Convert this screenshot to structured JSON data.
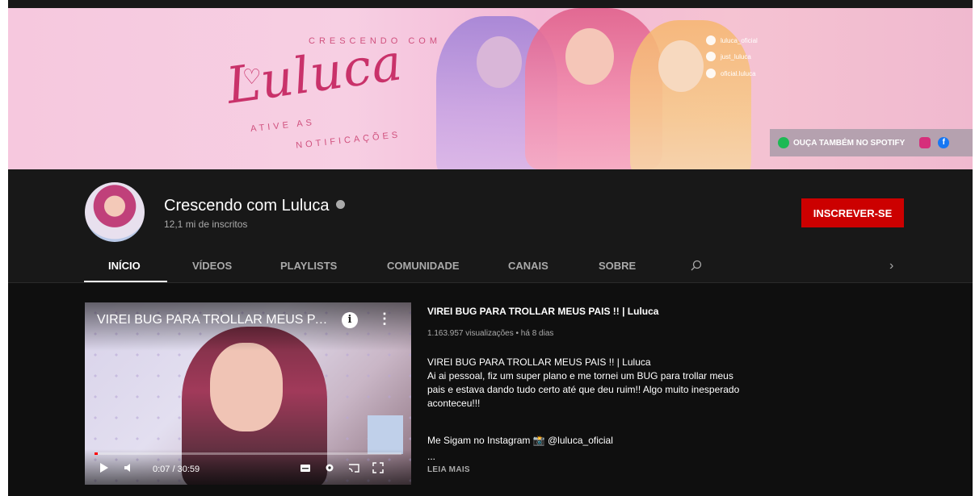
{
  "banner": {
    "brand_top": "CRESCENDO COM",
    "brand_logo": "Luluca",
    "note_line1": "ATIVE AS",
    "note_line2": "NOTIFICAÇÕES",
    "social": [
      {
        "icon": "instagram-icon",
        "handle": "luluca_oficial"
      },
      {
        "icon": "tiktok-icon",
        "handle": "just_luluca"
      },
      {
        "icon": "facebook-icon",
        "handle": "oficial.luluca"
      }
    ],
    "spotify_label": "OUÇA TAMBÉM NO SPOTIFY",
    "colors": {
      "accent": "#c9326a",
      "spotify": "#1db954"
    }
  },
  "channel": {
    "name": "Crescendo com Luluca",
    "subscribers": "12,1 mi de inscritos",
    "subscribe_label": "INSCREVER-SE",
    "subscribe_color": "#cc0000"
  },
  "tabs": [
    {
      "label": "INÍCIO",
      "active": true
    },
    {
      "label": "VÍDEOS",
      "active": false
    },
    {
      "label": "PLAYLISTS",
      "active": false
    },
    {
      "label": "COMUNIDADE",
      "active": false
    },
    {
      "label": "CANAIS",
      "active": false
    },
    {
      "label": "SOBRE",
      "active": false
    }
  ],
  "player": {
    "title": "VIREI BUG PARA TROLLAR MEUS PAI...",
    "time": "0:07 / 30:59",
    "progress_fraction": 0.004
  },
  "video": {
    "title": "VIREI BUG PARA TROLLAR MEUS PAIS !! | Luluca",
    "meta": "1.163.957 visualizações • há 8 dias",
    "desc_title": "VIREI BUG PARA TROLLAR MEUS PAIS !! | Luluca",
    "desc_body": "Ai ai pessoal, fiz um super plano e me tornei um BUG para trollar meus pais e estava dando tudo certo até que deu ruim!! Algo muito inesperado aconteceu!!!",
    "insta_line": "Me Sigam no Instagram 📸 @luluca_oficial",
    "ellipsis": "...",
    "read_more": "LEIA MAIS"
  }
}
